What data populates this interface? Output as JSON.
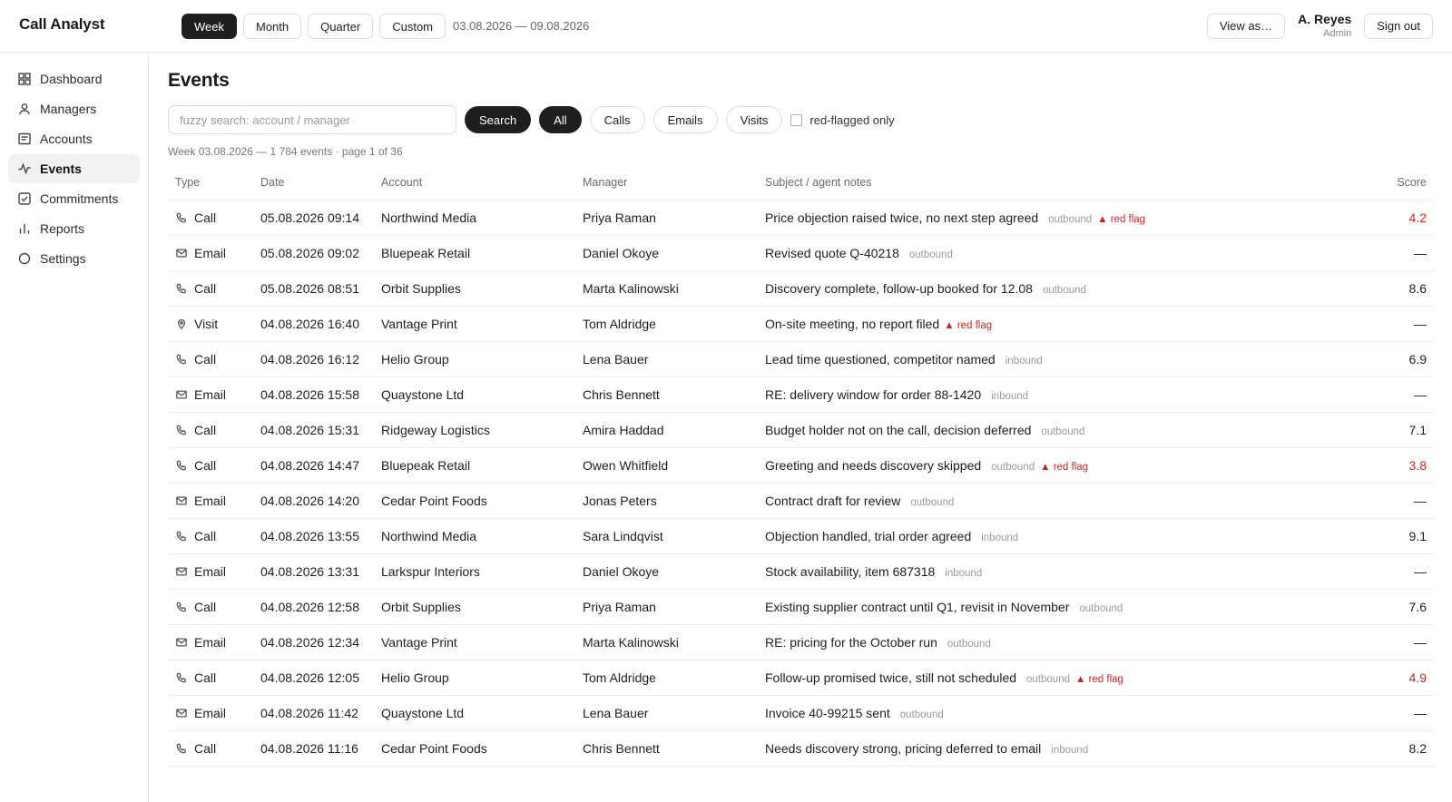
{
  "app": {
    "title": "Call Analyst"
  },
  "topbar": {
    "ranges": [
      {
        "label": "Week",
        "active": true
      },
      {
        "label": "Month",
        "active": false
      },
      {
        "label": "Quarter",
        "active": false
      },
      {
        "label": "Custom",
        "active": false
      }
    ],
    "date_range": "03.08.2026 — 09.08.2026",
    "view_as_label": "View as…",
    "user_name": "A. Reyes",
    "user_role": "Admin",
    "sign_out_label": "Sign out"
  },
  "sidebar": {
    "items": [
      {
        "label": "Dashboard",
        "icon": "grid-icon",
        "active": false
      },
      {
        "label": "Managers",
        "icon": "user-icon",
        "active": false
      },
      {
        "label": "Accounts",
        "icon": "card-icon",
        "active": false
      },
      {
        "label": "Events",
        "icon": "activity-icon",
        "active": true
      },
      {
        "label": "Commitments",
        "icon": "check-square-icon",
        "active": false
      },
      {
        "label": "Reports",
        "icon": "bar-chart-icon",
        "active": false
      },
      {
        "label": "Settings",
        "icon": "circle-icon",
        "active": false
      }
    ]
  },
  "main": {
    "title": "Events",
    "search": {
      "placeholder": "fuzzy search: account / manager",
      "value": "",
      "button_label": "Search"
    },
    "filters": [
      {
        "label": "All",
        "active": true
      },
      {
        "label": "Calls",
        "active": false
      },
      {
        "label": "Emails",
        "active": false
      },
      {
        "label": "Visits",
        "active": false
      }
    ],
    "red_flag_filter_label": "red-flagged only",
    "summary": "Week 03.08.2026 — 1 784 events · page 1 of 36"
  },
  "table": {
    "columns": [
      "Type",
      "Date",
      "Account",
      "Manager",
      "Subject / agent notes",
      "Score"
    ],
    "rows": [
      {
        "type": "Call",
        "date": "05.08.2026 09:14",
        "account": "Northwind Media",
        "manager": "Priya Raman",
        "subject": "Price objection raised twice, no next step agreed",
        "direction": "outbound",
        "flag": "▲ red flag",
        "score": "4.2"
      },
      {
        "type": "Email",
        "date": "05.08.2026 09:02",
        "account": "Bluepeak Retail",
        "manager": "Daniel Okoye",
        "subject": "Revised quote Q-40218",
        "direction": "outbound",
        "flag": "",
        "score": "—"
      },
      {
        "type": "Call",
        "date": "05.08.2026 08:51",
        "account": "Orbit Supplies",
        "manager": "Marta Kalinowski",
        "subject": "Discovery complete, follow-up booked for 12.08",
        "direction": "outbound",
        "flag": "",
        "score": "8.6"
      },
      {
        "type": "Visit",
        "date": "04.08.2026 16:40",
        "account": "Vantage Print",
        "manager": "Tom Aldridge",
        "subject": "On-site meeting, no report filed",
        "direction": "",
        "flag": "▲ red flag",
        "score": "—"
      },
      {
        "type": "Call",
        "date": "04.08.2026 16:12",
        "account": "Helio Group",
        "manager": "Lena Bauer",
        "subject": "Lead time questioned, competitor named",
        "direction": "inbound",
        "flag": "",
        "score": "6.9"
      },
      {
        "type": "Email",
        "date": "04.08.2026 15:58",
        "account": "Quaystone Ltd",
        "manager": "Chris Bennett",
        "subject": "RE: delivery window for order 88-1420",
        "direction": "inbound",
        "flag": "",
        "score": "—"
      },
      {
        "type": "Call",
        "date": "04.08.2026 15:31",
        "account": "Ridgeway Logistics",
        "manager": "Amira Haddad",
        "subject": "Budget holder not on the call, decision deferred",
        "direction": "outbound",
        "flag": "",
        "score": "7.1"
      },
      {
        "type": "Call",
        "date": "04.08.2026 14:47",
        "account": "Bluepeak Retail",
        "manager": "Owen Whitfield",
        "subject": "Greeting and needs discovery skipped",
        "direction": "outbound",
        "flag": "▲ red flag",
        "score": "3.8"
      },
      {
        "type": "Email",
        "date": "04.08.2026 14:20",
        "account": "Cedar Point Foods",
        "manager": "Jonas Peters",
        "subject": "Contract draft for review",
        "direction": "outbound",
        "flag": "",
        "score": "—"
      },
      {
        "type": "Call",
        "date": "04.08.2026 13:55",
        "account": "Northwind Media",
        "manager": "Sara Lindqvist",
        "subject": "Objection handled, trial order agreed",
        "direction": "inbound",
        "flag": "",
        "score": "9.1"
      },
      {
        "type": "Email",
        "date": "04.08.2026 13:31",
        "account": "Larkspur Interiors",
        "manager": "Daniel Okoye",
        "subject": "Stock availability, item 687318",
        "direction": "inbound",
        "flag": "",
        "score": "—"
      },
      {
        "type": "Call",
        "date": "04.08.2026 12:58",
        "account": "Orbit Supplies",
        "manager": "Priya Raman",
        "subject": "Existing supplier contract until Q1, revisit in November",
        "direction": "outbound",
        "flag": "",
        "score": "7.6"
      },
      {
        "type": "Email",
        "date": "04.08.2026 12:34",
        "account": "Vantage Print",
        "manager": "Marta Kalinowski",
        "subject": "RE: pricing for the October run",
        "direction": "outbound",
        "flag": "",
        "score": "—"
      },
      {
        "type": "Call",
        "date": "04.08.2026 12:05",
        "account": "Helio Group",
        "manager": "Tom Aldridge",
        "subject": "Follow-up promised twice, still not scheduled",
        "direction": "outbound",
        "flag": "▲ red flag",
        "score": "4.9"
      },
      {
        "type": "Email",
        "date": "04.08.2026 11:42",
        "account": "Quaystone Ltd",
        "manager": "Lena Bauer",
        "subject": "Invoice 40-99215 sent",
        "direction": "outbound",
        "flag": "",
        "score": "—"
      },
      {
        "type": "Call",
        "date": "04.08.2026 11:16",
        "account": "Cedar Point Foods",
        "manager": "Chris Bennett",
        "subject": "Needs discovery strong, pricing deferred to email",
        "direction": "inbound",
        "flag": "",
        "score": "8.2"
      }
    ]
  },
  "colors": {
    "accent": "#1f1f1f",
    "flag": "#c62828",
    "muted": "#9a9a9a"
  }
}
